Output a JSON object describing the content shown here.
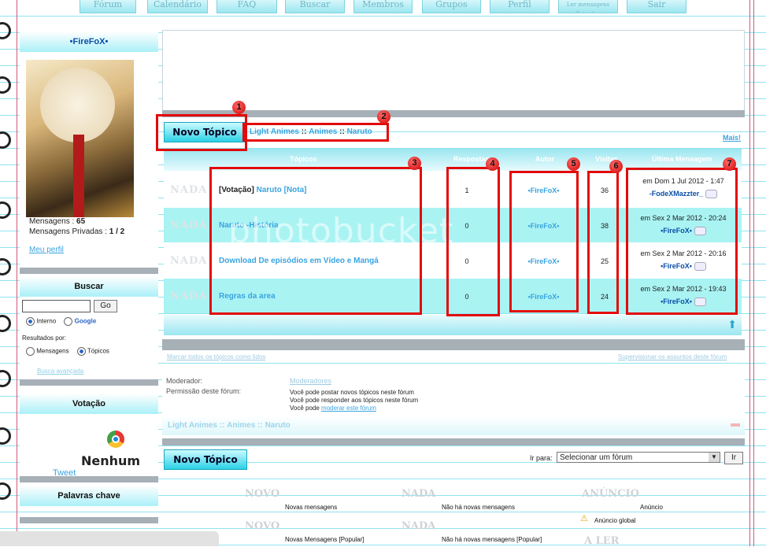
{
  "nav": [
    "Fórum",
    "Calendário",
    "FAQ",
    "Buscar",
    "Membros",
    "Grupos",
    "Perfil",
    "Ler mensagens Privadas",
    "Sair"
  ],
  "profile": {
    "username": "•FireFoX•",
    "posts_label": "Mensagens :",
    "posts": "65",
    "pm_label": "Mensagens Privadas :",
    "pm": "1 / 2",
    "my_profile": "Meu perfil"
  },
  "search": {
    "title": "Buscar",
    "go": "Go",
    "internal": "Interno",
    "google": "Google",
    "results_by": "Resultados por:",
    "posts_opt": "Mensagens",
    "topics_opt": "Tópicos",
    "advanced": "Busca avançada"
  },
  "poll": {
    "title": "Votação",
    "none": "Nenhum",
    "tweet": "Tweet"
  },
  "keywords": {
    "title": "Palavras chave"
  },
  "forum": {
    "new_topic": "Novo Tópico",
    "breadcrumb": [
      "Light Animes",
      "Animes",
      "Naruto"
    ],
    "more": "Mais!",
    "headers": [
      "Tópicos",
      "Respostas",
      "Autor",
      "Visitas",
      "Última Mensagem"
    ],
    "topics": [
      {
        "prefix": "[Votação]",
        "title": "Naruto [Nota]",
        "replies": "1",
        "author": "•FireFoX•",
        "views": "36",
        "last_date": "em Dom 1 Jul 2012 - 1:47",
        "last_user": "-FodeXMazzter_"
      },
      {
        "prefix": "",
        "title": "Naruto -História",
        "replies": "0",
        "author": "•FireFoX•",
        "views": "38",
        "last_date": "em Sex 2 Mar 2012 - 20:24",
        "last_user": "•FireFoX•"
      },
      {
        "prefix": "",
        "title": "Download De episódios em Vídeo e Mangá",
        "replies": "0",
        "author": "•FireFoX•",
        "views": "25",
        "last_date": "em Sex 2 Mar 2012 - 20:16",
        "last_user": "•FireFoX•"
      },
      {
        "prefix": "",
        "title": "Regras da area",
        "replies": "0",
        "author": "•FireFoX•",
        "views": "24",
        "last_date": "em Sex 2 Mar 2012 - 19:43",
        "last_user": "•FireFoX•"
      }
    ],
    "nada": "NADA",
    "mark_read": "Marcar todos os tópicos como lidos",
    "supervise": "Supervisionar os assuntos deste fórum",
    "moderator_label": "Moderador:",
    "moderator_value": "Moderadores",
    "permissions_label": "Permissão deste fórum:",
    "perm1": "Você pode postar novos tópicos neste fórum",
    "perm2": "Você pode responder aos tópicos neste fórum",
    "perm3_prefix": "Você pode",
    "perm3_link": "moderar este fórum",
    "jump_label": "Ir para:",
    "jump_value": "Selecionar um fórum",
    "jump_go": "Ir"
  },
  "legend": {
    "novo": "NOVO",
    "nada": "NADA",
    "anuncio": "ANÚNCIO",
    "aler": "A LER",
    "new_posts": "Novas mensagens",
    "no_new": "Não há novas mensagens",
    "announcement": "Anúncio",
    "new_popular": "Novas Mensagens [Popular]",
    "no_new_popular": "Não há novas mensagens [Popular]",
    "global": "Anúncio global"
  },
  "watermark": "photobucket",
  "badges": [
    "1",
    "2",
    "3",
    "4",
    "5",
    "6",
    "7"
  ],
  "colors": {
    "accent": "#3aa4e0",
    "highlight": "#e30a0a",
    "cyan": "#8fe3f0"
  }
}
